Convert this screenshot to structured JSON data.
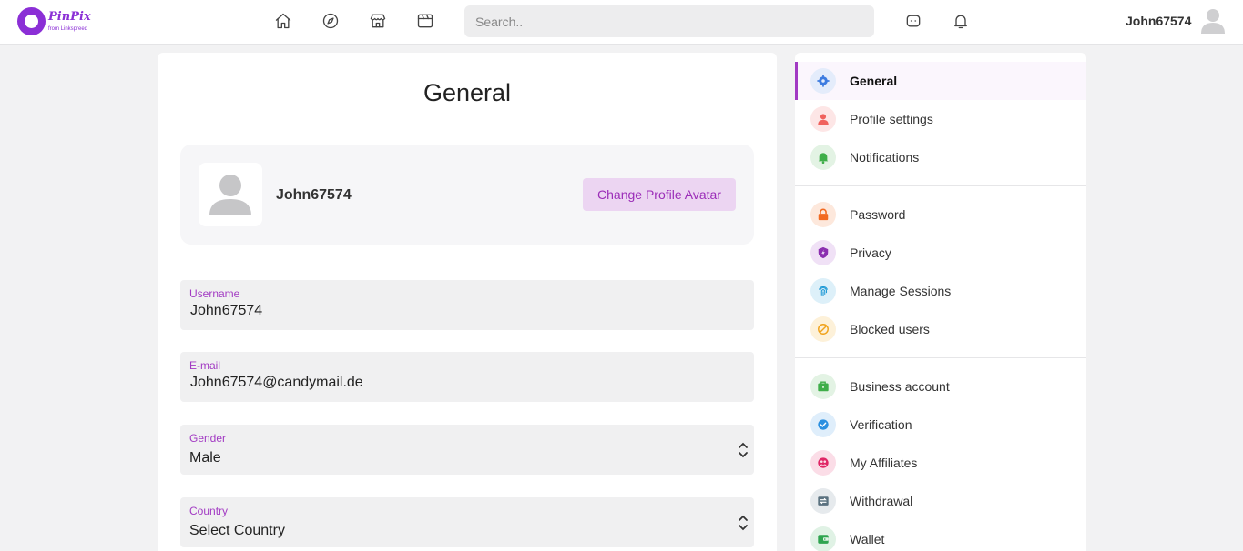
{
  "brand": {
    "name": "PinPix",
    "tagline": "from Linkspreed"
  },
  "search": {
    "placeholder": "Search.."
  },
  "user": {
    "name": "John67574"
  },
  "page": {
    "title": "General"
  },
  "profile": {
    "name": "John67574",
    "change_avatar_label": "Change Profile Avatar"
  },
  "form": {
    "username": {
      "label": "Username",
      "value": "John67574"
    },
    "email": {
      "label": "E-mail",
      "value": "John67574@candymail.de"
    },
    "gender": {
      "label": "Gender",
      "value": "Male"
    },
    "country": {
      "label": "Country",
      "value": "Select Country"
    }
  },
  "sidebar": {
    "items": [
      {
        "label": "General",
        "icon": "gear-icon",
        "color": "#3d7be0",
        "bg": "#e4ecfb",
        "active": true
      },
      {
        "label": "Profile settings",
        "icon": "user-icon",
        "color": "#f0625d",
        "bg": "#fde6e6"
      },
      {
        "label": "Notifications",
        "icon": "bell-icon",
        "color": "#3fae49",
        "bg": "#e3f3e4"
      },
      {
        "label": "Password",
        "icon": "lock-icon",
        "color": "#f26a21",
        "bg": "#fde8dc"
      },
      {
        "label": "Privacy",
        "icon": "shield-icon",
        "color": "#8b2fb0",
        "bg": "#f0e1f6"
      },
      {
        "label": "Manage Sessions",
        "icon": "fingerprint-icon",
        "color": "#1f9ad6",
        "bg": "#ddf0f9"
      },
      {
        "label": "Blocked users",
        "icon": "block-icon",
        "color": "#f0a21a",
        "bg": "#fdf1d9"
      },
      {
        "label": "Business account",
        "icon": "briefcase-icon",
        "color": "#3fae49",
        "bg": "#e3f3e4"
      },
      {
        "label": "Verification",
        "icon": "check-badge-icon",
        "color": "#2a8fe0",
        "bg": "#dfeefb"
      },
      {
        "label": "My Affiliates",
        "icon": "affiliates-icon",
        "color": "#e02666",
        "bg": "#fbdde7"
      },
      {
        "label": "Withdrawal",
        "icon": "exchange-icon",
        "color": "#5b7280",
        "bg": "#e6eaed"
      },
      {
        "label": "Wallet",
        "icon": "wallet-icon",
        "color": "#2ea44f",
        "bg": "#e0f2e5"
      }
    ]
  }
}
